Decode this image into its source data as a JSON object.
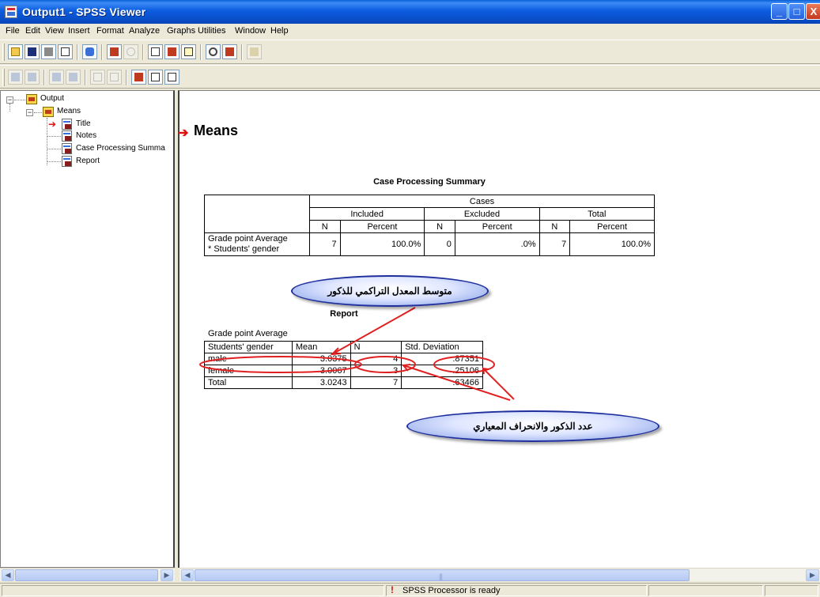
{
  "window": {
    "title": "Output1 - SPSS Viewer",
    "buttons": {
      "minimize": "_",
      "maximize": "□",
      "close": "X"
    }
  },
  "menu": [
    "File",
    "Edit",
    "View",
    "Insert",
    "Format",
    "Analyze",
    "Graphs",
    "Utilities",
    "Window",
    "Help"
  ],
  "toolbar1": [
    {
      "icon": "open-icon",
      "enabled": true
    },
    {
      "icon": "save-icon",
      "enabled": true
    },
    {
      "icon": "print-icon",
      "enabled": true
    },
    {
      "icon": "print-preview-icon",
      "enabled": true
    },
    {
      "icon": "export-icon",
      "enabled": true
    },
    {
      "icon": "recall-dialog-icon",
      "enabled": true
    },
    {
      "icon": "undo-icon",
      "enabled": false
    },
    {
      "icon": "goto-data-icon",
      "enabled": true
    },
    {
      "icon": "goto-chart-icon",
      "enabled": true
    },
    {
      "icon": "variables-icon",
      "enabled": true
    },
    {
      "icon": "use-sets-icon",
      "enabled": true
    },
    {
      "icon": "designate-window-icon",
      "enabled": true
    },
    {
      "icon": "run-icon",
      "enabled": false
    }
  ],
  "toolbar2": [
    {
      "icon": "promote-icon",
      "enabled": false
    },
    {
      "icon": "demote-icon",
      "enabled": false
    },
    {
      "icon": "expand-icon",
      "enabled": false
    },
    {
      "icon": "collapse-icon",
      "enabled": false
    },
    {
      "icon": "show-icon",
      "enabled": false
    },
    {
      "icon": "hide-icon",
      "enabled": false
    },
    {
      "icon": "insert-heading-icon",
      "enabled": true
    },
    {
      "icon": "insert-title-icon",
      "enabled": true
    },
    {
      "icon": "insert-text-icon",
      "enabled": true
    }
  ],
  "outline": {
    "root": "Output",
    "child": "Means",
    "items": [
      "Title",
      "Notes",
      "Case Processing Summa",
      "Report"
    ]
  },
  "content": {
    "heading": "Means",
    "case_summary": {
      "title": "Case Processing Summary",
      "group_header": "Cases",
      "sub_headers": [
        "Included",
        "Excluded",
        "Total"
      ],
      "col_headers": [
        "N",
        "Percent",
        "N",
        "Percent",
        "N",
        "Percent"
      ],
      "row_label_1": "Grade point Average",
      "row_label_2": "* Students' gender",
      "values": [
        "7",
        "100.0%",
        "0",
        ".0%",
        "7",
        "100.0%"
      ]
    },
    "report": {
      "title": "Report",
      "caption": "Grade point Average",
      "headers": [
        "Students' gender",
        "Mean",
        "N",
        "Std. Deviation"
      ],
      "rows": [
        {
          "label": "male",
          "mean": "3.0375",
          "n": "4",
          "sd": ".87351"
        },
        {
          "label": "female",
          "mean": "3.0067",
          "n": "3",
          "sd": ".25106"
        },
        {
          "label": "Total",
          "mean": "3.0243",
          "n": "7",
          "sd": ".63466"
        }
      ]
    },
    "annotations": {
      "top": "متوسط المعدل التراكمي للذكور",
      "bottom": "عدد الذكور والانحراف المعياري",
      "color": "#e02020"
    }
  },
  "status": {
    "text": "SPSS Processor  is ready"
  },
  "colors": {
    "titlebar": "#0a5fd8",
    "accent_red": "#e01010",
    "callout_border": "#1f2f9c"
  }
}
